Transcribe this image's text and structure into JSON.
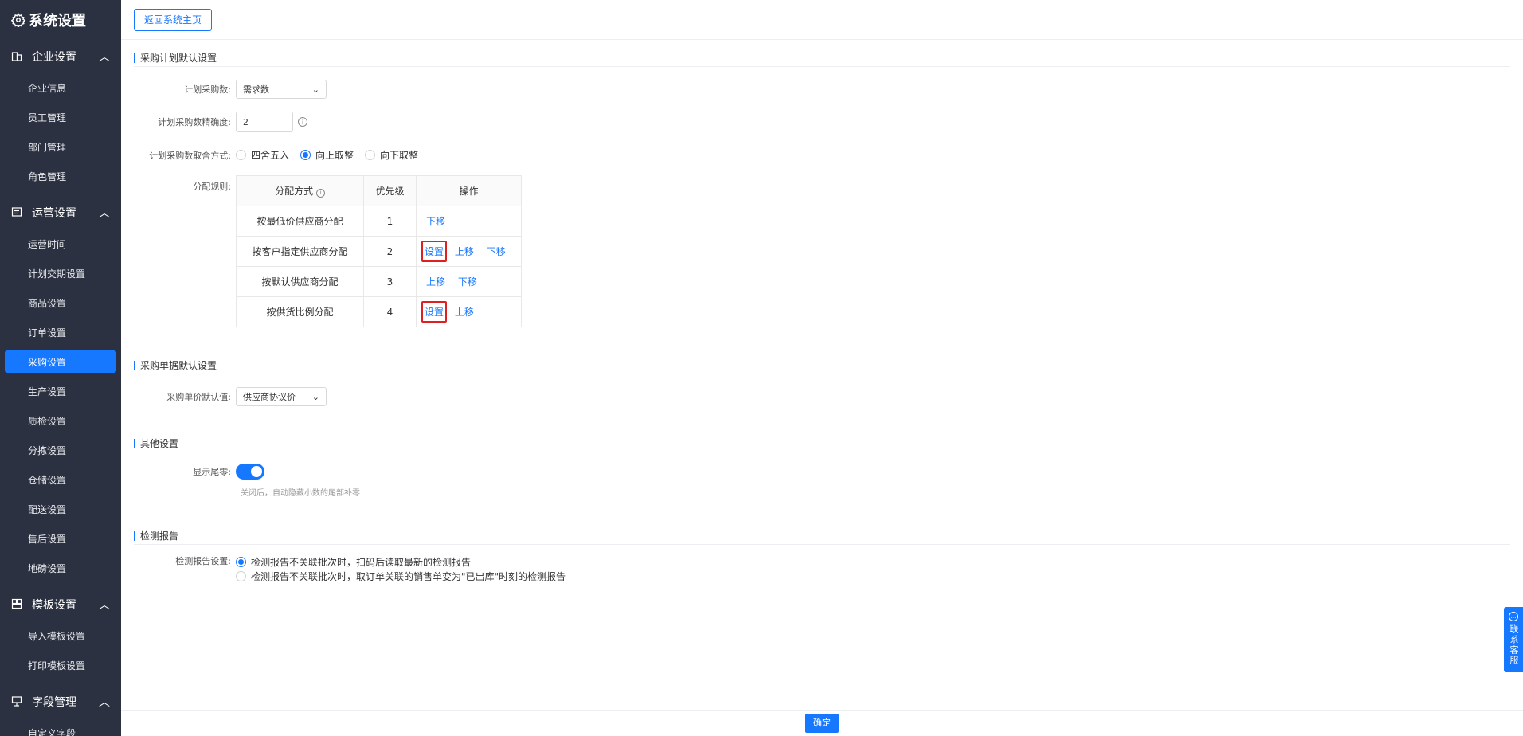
{
  "sidebar": {
    "title": "系统设置",
    "groups": [
      {
        "label": "企业设置",
        "items": [
          "企业信息",
          "员工管理",
          "部门管理",
          "角色管理"
        ]
      },
      {
        "label": "运营设置",
        "items": [
          "运营时间",
          "计划交期设置",
          "商品设置",
          "订单设置",
          "采购设置",
          "生产设置",
          "质检设置",
          "分拣设置",
          "仓储设置",
          "配送设置",
          "售后设置",
          "地磅设置"
        ]
      },
      {
        "label": "模板设置",
        "items": [
          "导入模板设置",
          "打印模板设置"
        ]
      },
      {
        "label": "字段管理",
        "items": [
          "自定义字段"
        ]
      }
    ],
    "active_item": "采购设置"
  },
  "topbar": {
    "back_button": "返回系统主页"
  },
  "sections": {
    "plan": {
      "title": "采购计划默认设置",
      "qty_label": "计划采购数:",
      "qty_value": "需求数",
      "precision_label": "计划采购数精确度:",
      "precision_value": "2",
      "rounding_label": "计划采购数取舍方式:",
      "rounding_options": [
        "四舍五入",
        "向上取整",
        "向下取整"
      ],
      "rounding_selected": 1,
      "rules_label": "分配规则:",
      "table_headers": [
        "分配方式",
        "优先级",
        "操作"
      ],
      "rows": [
        {
          "method": "按最低价供应商分配",
          "priority": "1",
          "ops": [
            "下移"
          ]
        },
        {
          "method": "按客户指定供应商分配",
          "priority": "2",
          "ops": [
            "设置",
            "上移",
            "下移"
          ]
        },
        {
          "method": "按默认供应商分配",
          "priority": "3",
          "ops": [
            "上移",
            "下移"
          ]
        },
        {
          "method": "按供货比例分配",
          "priority": "4",
          "ops": [
            "设置",
            "上移"
          ]
        }
      ]
    },
    "order": {
      "title": "采购单据默认设置",
      "price_label": "采购单价默认值:",
      "price_value": "供应商协议价"
    },
    "other": {
      "title": "其他设置",
      "tail_label": "显示尾零:",
      "tail_on": true,
      "tail_hint": "关闭后，自动隐藏小数的尾部补零"
    },
    "report": {
      "title": "检测报告",
      "report_label": "检测报告设置:",
      "options": [
        "检测报告不关联批次时，扫码后读取最新的检测报告",
        "检测报告不关联批次时，取订单关联的销售单变为\"已出库\"时刻的检测报告"
      ],
      "selected": 0
    }
  },
  "footer": {
    "confirm": "确定"
  },
  "float": {
    "customer_service": "联系客服"
  },
  "colors": {
    "sidebar_bg": "#2b3140",
    "accent": "#1677ff",
    "highlight": "#e02020"
  }
}
